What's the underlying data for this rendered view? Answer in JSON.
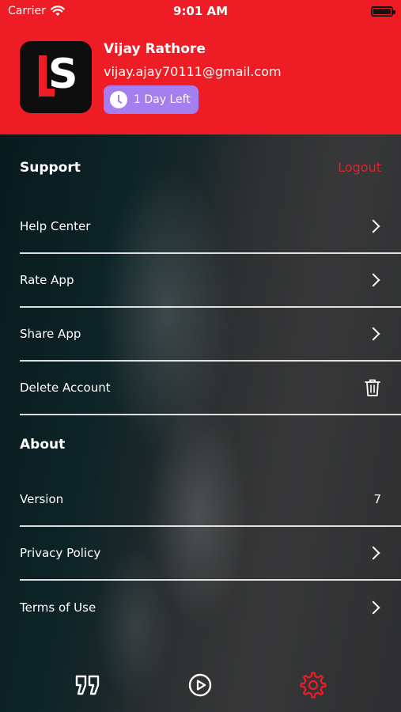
{
  "status_bar": {
    "carrier": "Carrier",
    "time": "9:01 AM"
  },
  "profile": {
    "name": "Vijay Rathore",
    "email": "vijay.ajay70111@gmail.com",
    "days_left": "1 Day Left",
    "badge_color": "#a57ef0"
  },
  "support": {
    "title": "Support",
    "logout_label": "Logout",
    "items": [
      {
        "label": "Help Center",
        "icon": "chevron-right-icon"
      },
      {
        "label": "Rate App",
        "icon": "chevron-right-icon"
      },
      {
        "label": "Share App",
        "icon": "chevron-right-icon"
      },
      {
        "label": "Delete Account",
        "icon": "trash-icon"
      }
    ]
  },
  "about": {
    "title": "About",
    "items": [
      {
        "label": "Version",
        "value": "7"
      },
      {
        "label": "Privacy Policy",
        "icon": "chevron-right-icon"
      },
      {
        "label": "Terms of Use",
        "icon": "chevron-right-icon"
      }
    ]
  },
  "tabs": [
    {
      "name": "quotes",
      "icon": "quote-icon",
      "active": false
    },
    {
      "name": "play",
      "icon": "play-circle-icon",
      "active": false
    },
    {
      "name": "settings",
      "icon": "gear-icon",
      "active": true
    }
  ],
  "colors": {
    "accent": "#ee1c25",
    "text": "#ffffff"
  }
}
